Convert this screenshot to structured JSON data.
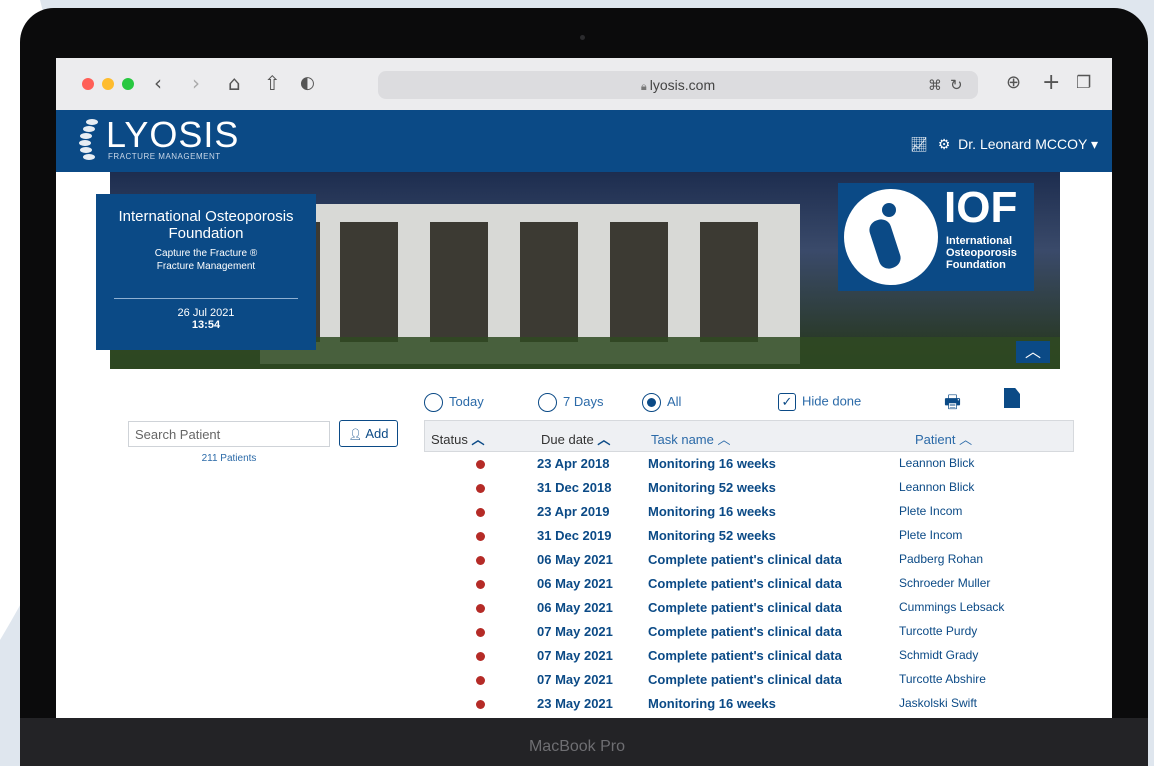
{
  "device": {
    "label": "MacBook Pro"
  },
  "browser": {
    "url": "lyosis.com"
  },
  "app": {
    "logo_text": "LYOSIS",
    "logo_sub": "FRACTURE MANAGEMENT",
    "user_name": "Dr. Leonard MCCOY ▾",
    "brand_color": "#0b4a86"
  },
  "banner": {
    "org_name": "International Osteoporosis Foundation",
    "line1": "Capture the Fracture ®",
    "line2": "Fracture Management",
    "date": "26 Jul 2021",
    "time": "13:54",
    "iof_short": "IOF",
    "iof_full_1": "International",
    "iof_full_2": "Osteoporosis",
    "iof_full_3": "Foundation"
  },
  "filters": {
    "today": "Today",
    "seven_days": "7 Days",
    "all": "All",
    "selected": "All",
    "hide_done": "Hide done",
    "hide_done_checked": true
  },
  "search": {
    "placeholder": "Search Patient",
    "add_label": "Add",
    "count": "211 Patients"
  },
  "table": {
    "headers": {
      "status": "Status",
      "due_date": "Due date",
      "task_name": "Task name",
      "patient": "Patient"
    },
    "status_color": "#b52b27",
    "rows": [
      {
        "due": "23 Apr 2018",
        "task": "Monitoring 16 weeks",
        "patient": "Leannon Blick"
      },
      {
        "due": "31 Dec 2018",
        "task": "Monitoring 52 weeks",
        "patient": "Leannon Blick"
      },
      {
        "due": "23 Apr 2019",
        "task": "Monitoring 16 weeks",
        "patient": "Plete Incom"
      },
      {
        "due": "31 Dec 2019",
        "task": "Monitoring 52 weeks",
        "patient": "Plete Incom"
      },
      {
        "due": "06 May 2021",
        "task": "Complete patient's clinical data",
        "patient": "Padberg Rohan"
      },
      {
        "due": "06 May 2021",
        "task": "Complete patient's clinical data",
        "patient": "Schroeder Muller"
      },
      {
        "due": "06 May 2021",
        "task": "Complete patient's clinical data",
        "patient": "Cummings Lebsack"
      },
      {
        "due": "07 May 2021",
        "task": "Complete patient's clinical data",
        "patient": "Turcotte Purdy"
      },
      {
        "due": "07 May 2021",
        "task": "Complete patient's clinical data",
        "patient": "Schmidt Grady"
      },
      {
        "due": "07 May 2021",
        "task": "Complete patient's clinical data",
        "patient": "Turcotte Abshire"
      },
      {
        "due": "23 May 2021",
        "task": "Monitoring 16 weeks",
        "patient": "Jaskolski Swift"
      }
    ]
  }
}
